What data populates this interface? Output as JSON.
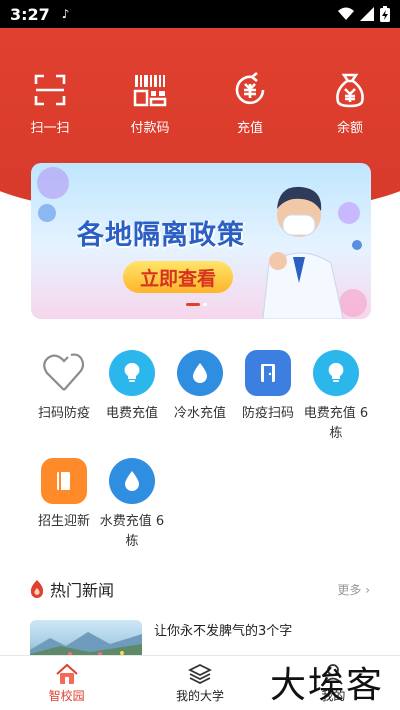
{
  "status": {
    "time": "3:27"
  },
  "quick_actions": [
    {
      "label": "扫一扫",
      "icon": "scan-icon"
    },
    {
      "label": "付款码",
      "icon": "barcode-icon"
    },
    {
      "label": "充值",
      "icon": "recharge-icon"
    },
    {
      "label": "余额",
      "icon": "money-bag-icon"
    }
  ],
  "banner": {
    "headline": "各地隔离政策",
    "cta": "立即查看"
  },
  "services": [
    {
      "label": "扫码防疫",
      "icon": "heart-outline-icon",
      "color": "#ffffff"
    },
    {
      "label": "电费充值",
      "icon": "lightbulb-icon",
      "color": "#2bb6ec"
    },
    {
      "label": "冷水充值",
      "icon": "water-drop-icon",
      "color": "#2f8ee0"
    },
    {
      "label": "防疫扫码",
      "icon": "door-icon",
      "color": "#3d7fe0"
    },
    {
      "label": "电费充值 6栋",
      "icon": "lightbulb-icon",
      "color": "#2bb6ec"
    },
    {
      "label": "招生迎新",
      "icon": "book-icon",
      "color": "#ff8a2a"
    },
    {
      "label": "水费充值 6栋",
      "icon": "water-drop-icon",
      "color": "#2f8ee0"
    }
  ],
  "news": {
    "title": "热门新闻",
    "more": "更多",
    "items": [
      {
        "headline": "让你永不发脾气的3个字"
      }
    ]
  },
  "tabs": [
    {
      "label": "智校园",
      "icon": "home-icon",
      "active": true
    },
    {
      "label": "我的大学",
      "icon": "layers-icon",
      "active": false
    },
    {
      "label": "我的",
      "icon": "user-icon",
      "active": false
    }
  ],
  "watermark": "大埃客",
  "colors": {
    "brand_red": "#e14030",
    "accent_blue": "#2f8ee0"
  }
}
